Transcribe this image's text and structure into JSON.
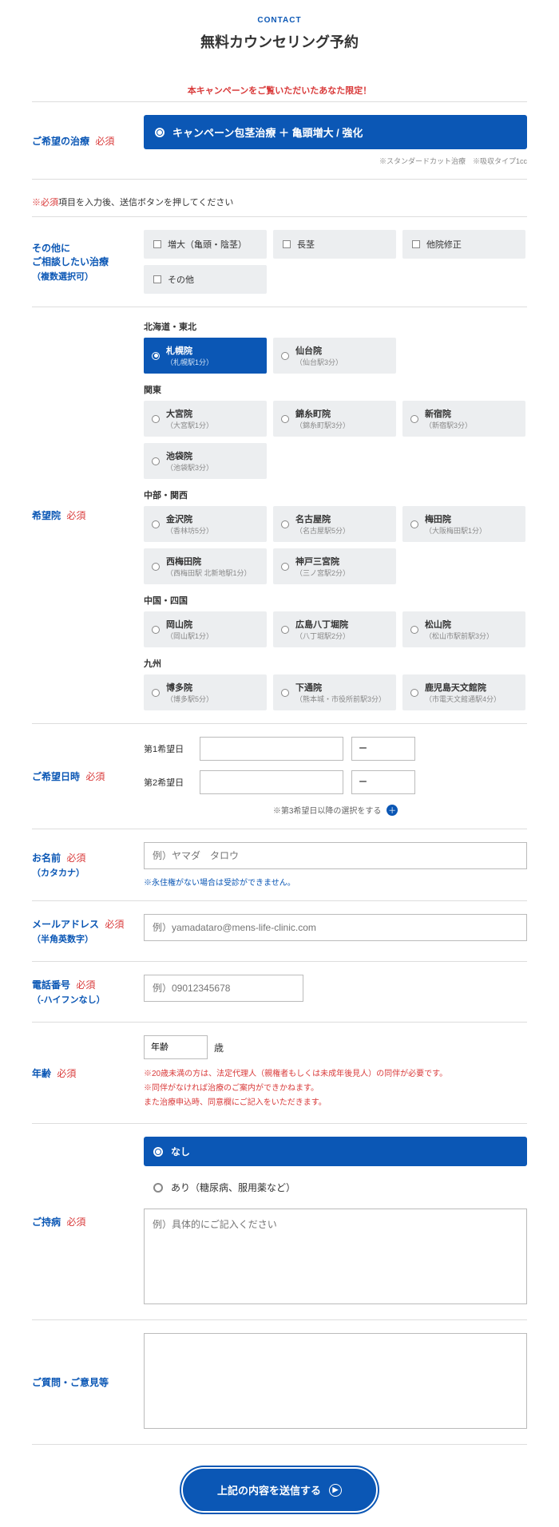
{
  "header": {
    "sub": "CONTACT",
    "title": "無料カウンセリング予約"
  },
  "campaign_banner": "本キャンペーンをご覧いただいたあなた限定！",
  "treatment": {
    "label": "ご希望の治療",
    "req": "必須",
    "selected": "キャンペーン包茎治療 ＋ 亀頭増大 / 強化",
    "note": "※スタンダードカット治療　※吸収タイプ1cc"
  },
  "required_note_star": "※必須",
  "required_note_rest": "項目を入力後、送信ボタンを押してください",
  "other": {
    "label1": "その他に",
    "label2": "ご相談したい治療",
    "label3": "（複数選択可）",
    "items": [
      "増大（亀頭・陰茎）",
      "長茎",
      "他院修正",
      "その他"
    ]
  },
  "clinic": {
    "label": "希望院",
    "req": "必須",
    "regions": [
      {
        "name": "北海道・東北",
        "items": [
          {
            "name": "札幌院",
            "sub": "（札幌駅1分）",
            "selected": true
          },
          {
            "name": "仙台院",
            "sub": "（仙台駅3分）"
          }
        ]
      },
      {
        "name": "関東",
        "items": [
          {
            "name": "大宮院",
            "sub": "（大宮駅1分）"
          },
          {
            "name": "錦糸町院",
            "sub": "（錦糸町駅3分）"
          },
          {
            "name": "新宿院",
            "sub": "（新宿駅3分）"
          },
          {
            "name": "池袋院",
            "sub": "（池袋駅3分）"
          }
        ]
      },
      {
        "name": "中部・関西",
        "items": [
          {
            "name": "金沢院",
            "sub": "（香林坊5分）"
          },
          {
            "name": "名古屋院",
            "sub": "（名古屋駅5分）"
          },
          {
            "name": "梅田院",
            "sub": "（大阪梅田駅1分）"
          },
          {
            "name": "西梅田院",
            "sub": "（西梅田駅 北新地駅1分）"
          },
          {
            "name": "神戸三宮院",
            "sub": "（三ノ宮駅2分）"
          }
        ]
      },
      {
        "name": "中国・四国",
        "items": [
          {
            "name": "岡山院",
            "sub": "（岡山駅1分）"
          },
          {
            "name": "広島八丁堀院",
            "sub": "（八丁堀駅2分）"
          },
          {
            "name": "松山院",
            "sub": "（松山市駅前駅3分）"
          }
        ]
      },
      {
        "name": "九州",
        "items": [
          {
            "name": "博多院",
            "sub": "（博多駅5分）"
          },
          {
            "name": "下通院",
            "sub": "（熊本城・市役所前駅3分）"
          },
          {
            "name": "鹿児島天文館院",
            "sub": "（市電天文館通駅4分）"
          }
        ]
      }
    ]
  },
  "datetime": {
    "label": "ご希望日時",
    "req": "必須",
    "row1": "第1希望日",
    "row2": "第2希望日",
    "dash": "ー",
    "note": "※第3希望日以降の選択をする"
  },
  "name_field": {
    "label": "お名前",
    "req": "必須",
    "sub": "（カタカナ）",
    "placeholder": "例）ヤマダ　タロウ",
    "note": "※永住権がない場合は受診ができません。"
  },
  "email": {
    "label": "メールアドレス",
    "req": "必須",
    "sub": "（半角英数字）",
    "placeholder": "例）yamadataro@mens-life-clinic.com"
  },
  "phone": {
    "label": "電話番号",
    "req": "必須",
    "sub": "（-ハイフンなし）",
    "placeholder": "例）09012345678"
  },
  "age": {
    "label": "年齢",
    "req": "必須",
    "select": "年齢",
    "unit": "歳",
    "note1": "※20歳未満の方は、法定代理人（親権者もしくは未成年後見人）の同伴が必要です。",
    "note2": "※同伴がなければ治療のご案内ができかねます。",
    "note3": "また治療申込時、同意欄にご記入をいただきます。"
  },
  "condition": {
    "label": "ご持病",
    "req": "必須",
    "opt_none": "なし",
    "opt_yes": "あり（糖尿病、服用薬など）",
    "placeholder": "例）具体的にご記入ください"
  },
  "question": {
    "label": "ご質問・ご意見等"
  },
  "submit": "上記の内容を送信する"
}
